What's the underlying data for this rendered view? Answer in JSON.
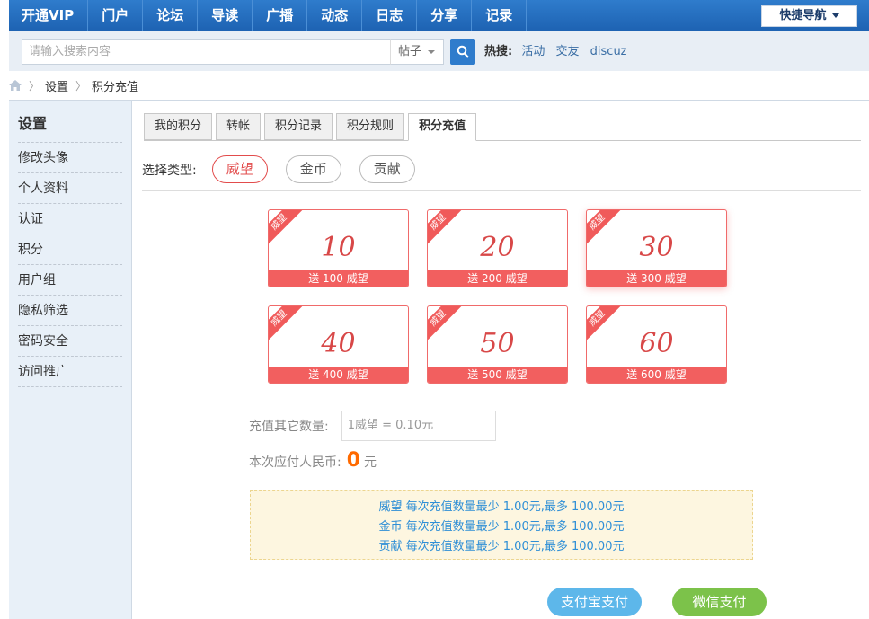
{
  "topnav": {
    "items": [
      "开通VIP",
      "门户",
      "论坛",
      "导读",
      "广播",
      "动态",
      "日志",
      "分享",
      "记录"
    ],
    "quick_nav": "快捷导航"
  },
  "search": {
    "placeholder": "请输入搜索内容",
    "type": "帖子",
    "hot_label": "热搜:",
    "hot_links": [
      "活动",
      "交友",
      "discuz"
    ]
  },
  "breadcrumb": [
    "设置",
    "积分充值"
  ],
  "sidebar": {
    "title": "设置",
    "items": [
      "修改头像",
      "个人资料",
      "认证",
      "积分",
      "用户组",
      "隐私筛选",
      "密码安全",
      "访问推广"
    ]
  },
  "tabs": [
    "我的积分",
    "转帐",
    "积分记录",
    "积分规则",
    "积分充值"
  ],
  "active_tab": "积分充值",
  "type_select": {
    "label": "选择类型:",
    "options": [
      "威望",
      "金币",
      "贡献"
    ],
    "selected": "威望"
  },
  "cards": [
    {
      "ribbon": "威望",
      "amount": "10",
      "bonus": "送 100 威望"
    },
    {
      "ribbon": "威望",
      "amount": "20",
      "bonus": "送 200 威望"
    },
    {
      "ribbon": "威望",
      "amount": "30",
      "bonus": "送 300 威望"
    },
    {
      "ribbon": "威望",
      "amount": "40",
      "bonus": "送 400 威望"
    },
    {
      "ribbon": "威望",
      "amount": "50",
      "bonus": "送 500 威望"
    },
    {
      "ribbon": "威望",
      "amount": "60",
      "bonus": "送 600 威望"
    }
  ],
  "other": {
    "label": "充值其它数量:",
    "placeholder": "1威望 = 0.10元",
    "pay_label": "本次应付人民币:",
    "pay_amount": "0",
    "pay_unit": "元"
  },
  "notice": [
    "威望 每次充值数量最少 1.00元,最多 100.00元",
    "金币 每次充值数量最少 1.00元,最多 100.00元",
    "贡献 每次充值数量最少 1.00元,最多 100.00元"
  ],
  "buttons": {
    "alipay": "支付宝支付",
    "wechat": "微信支付"
  },
  "colors": {
    "nav": "#2f7ccc",
    "accent_red": "#f25f5f",
    "pay_amount": "#ff6a00",
    "alipay": "#5db7ea",
    "wechat": "#7cc24a"
  }
}
